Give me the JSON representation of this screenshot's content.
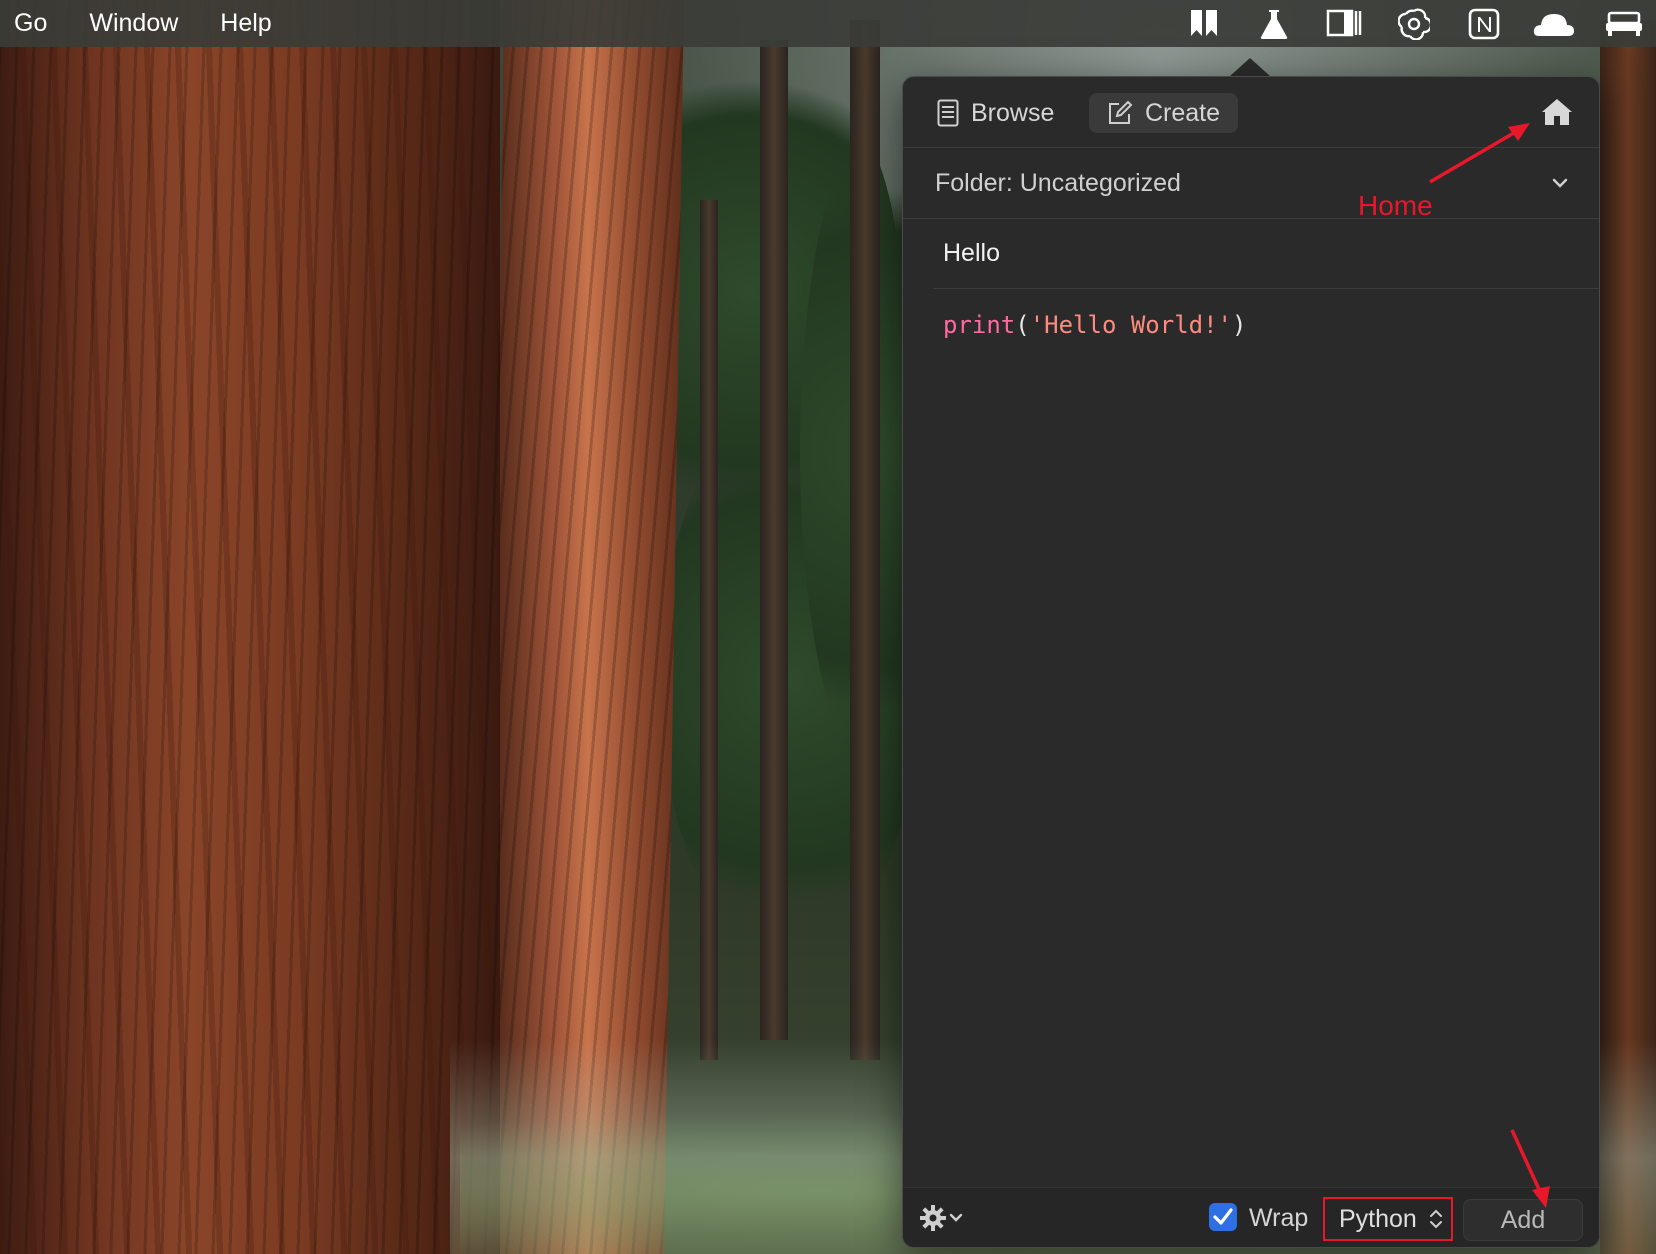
{
  "menubar": {
    "items": [
      "Go",
      "Window",
      "Help"
    ],
    "status_icons": [
      "bookmark-icon",
      "flask-icon",
      "sidebar-panel-icon",
      "openai-icon",
      "notion-icon",
      "cloud-icon",
      "bed-icon"
    ]
  },
  "panel": {
    "tabs": {
      "browse_label": "Browse",
      "create_label": "Create"
    },
    "folder_label": "Folder: Uncategorized",
    "title_value": "Hello",
    "code": {
      "function": "print",
      "open_paren": "(",
      "string": "'Hello World!'",
      "close_paren": ")"
    },
    "footer": {
      "wrap_label": "Wrap",
      "wrap_checked": true,
      "language": "Python",
      "add_label": "Add"
    }
  },
  "annotations": {
    "home_label": "Home",
    "color": "#e8182a"
  },
  "colors": {
    "accent_checkbox": "#2f6fe4",
    "code_function": "#ff6aa0",
    "code_string": "#ff8a80",
    "panel_bg": "#2a2a2a"
  }
}
